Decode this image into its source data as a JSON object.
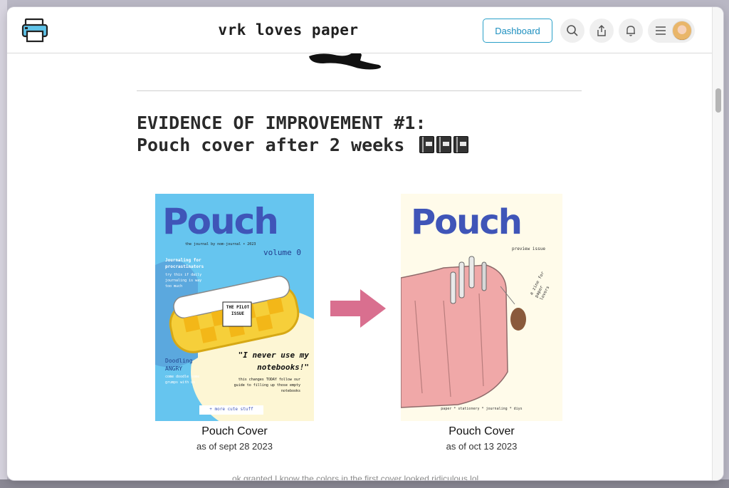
{
  "header": {
    "site_title": "vrk loves paper",
    "dashboard_label": "Dashboard",
    "icons": [
      "printer-logo-icon",
      "search-icon",
      "share-icon",
      "bell-icon",
      "menu-icon",
      "avatar"
    ]
  },
  "article": {
    "heading_line1": "EVIDENCE OF IMPROVEMENT #1:",
    "heading_line2": "Pouch cover after 2 weeks",
    "heading_emoji": "notebook-icons",
    "cut_off_text": "ok granted I know the colors in the first cover looked ridiculous lol"
  },
  "covers": [
    {
      "caption_title": "Pouch Cover",
      "caption_sub": "as of sept 28 2023",
      "cover_title": "Pouch",
      "byline": "the journal by nom-journal • 2023",
      "volume": "volume 0",
      "sidebar_heading": "Journaling for procrastinators",
      "sidebar_body": "try this if daily journaling is way too much",
      "pouch_label": "THE PILOT ISSUE",
      "section2_heading": "Doodling ANGRY",
      "section2_body": "come doodle some grumps with us",
      "quote": "\"I never use my notebooks!\"",
      "quote_sub": "this changes TODAY follow our guide to filling up those empty notebooks",
      "more_button": "+ more cute stuff"
    },
    {
      "caption_title": "Pouch Cover",
      "caption_sub": "as of oct 13 2023",
      "cover_title": "Pouch",
      "preview": "preview issue",
      "side_note": "a zine for paper lovers",
      "footer": "paper * stationery * journaling * diys"
    }
  ],
  "colors": {
    "accent": "#1d8fbf",
    "arrow": "#d96f8f",
    "cover1_bg": "#66c5ef",
    "cover2_bg": "#fffbea",
    "pouch_blue": "#3f55b8"
  }
}
